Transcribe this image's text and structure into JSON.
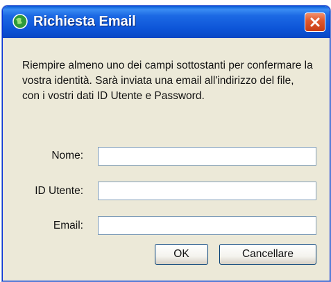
{
  "window": {
    "title": "Richiesta Email",
    "icon": "app-globe-icon",
    "close_icon": "close-icon"
  },
  "intro_text": "Riempire almeno uno dei campi sottostanti per confermare la vostra identità. Sarà inviata una email all'indirizzo del file, con i vostri dati ID Utente e Password.",
  "fields": [
    {
      "label": "Nome:",
      "value": "",
      "placeholder": ""
    },
    {
      "label": "ID Utente:",
      "value": "",
      "placeholder": ""
    },
    {
      "label": "Email:",
      "value": "",
      "placeholder": ""
    }
  ],
  "buttons": {
    "ok_label": "OK",
    "cancel_label": "Cancellare"
  },
  "colors": {
    "titlebar": "#0d55d8",
    "client": "#ece9d8",
    "close": "#e0592f"
  }
}
